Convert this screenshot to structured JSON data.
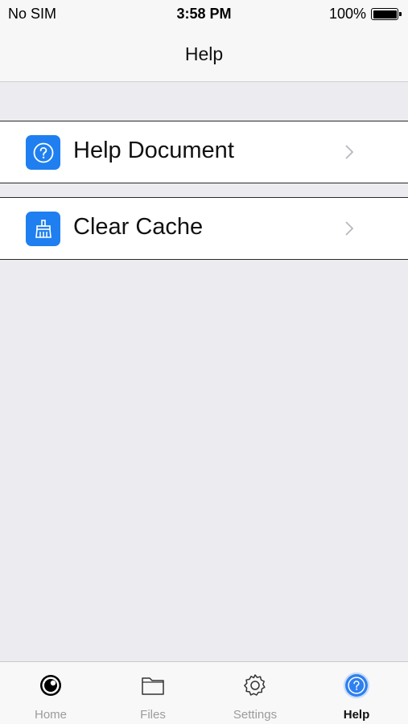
{
  "status_bar": {
    "carrier": "No SIM",
    "time": "3:58 PM",
    "battery": "100%"
  },
  "nav": {
    "title": "Help"
  },
  "list": {
    "items": [
      {
        "label": "Help Document",
        "icon": "question-circle-icon"
      },
      {
        "label": "Clear Cache",
        "icon": "broom-icon"
      }
    ]
  },
  "tab_bar": {
    "tabs": [
      {
        "label": "Home",
        "icon": "eye-icon",
        "active": false
      },
      {
        "label": "Files",
        "icon": "folder-icon",
        "active": false
      },
      {
        "label": "Settings",
        "icon": "gear-icon",
        "active": false
      },
      {
        "label": "Help",
        "icon": "question-circle-icon",
        "active": true
      }
    ]
  },
  "colors": {
    "accent": "#1f7ff0",
    "background": "#ececf0",
    "inactive_tab": "#9b9b9b"
  }
}
